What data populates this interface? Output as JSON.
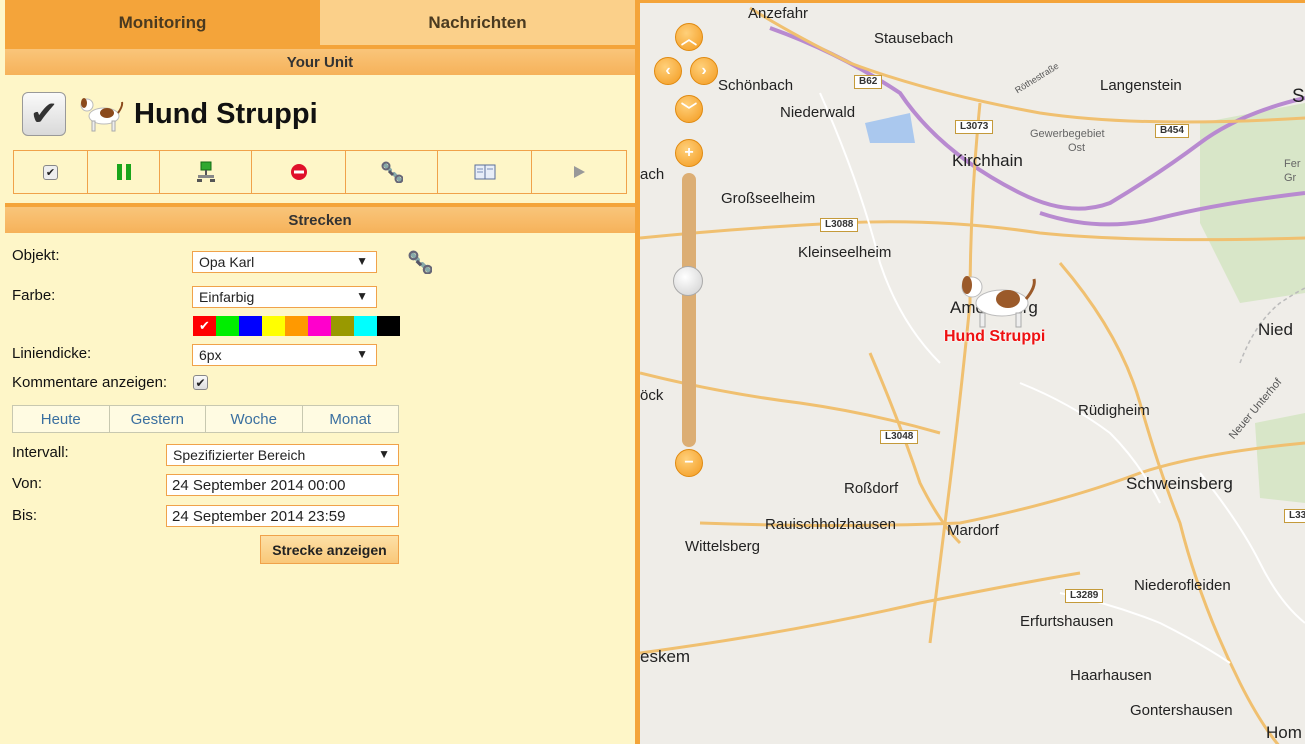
{
  "tabs": {
    "monitoring": "Monitoring",
    "messages": "Nachrichten"
  },
  "unit_section": {
    "title": "Your Unit",
    "unit_name": "Hund Struppi"
  },
  "track_section": {
    "title": "Strecken",
    "object_label": "Objekt:",
    "object_value": "Opa Karl",
    "color_label": "Farbe:",
    "color_value": "Einfarbig",
    "colors": [
      "#ff0000",
      "#00ee00",
      "#0000ff",
      "#ffff00",
      "#ff9900",
      "#ff00cc",
      "#999900",
      "#00ffff",
      "#000000"
    ],
    "width_label": "Liniendicke:",
    "width_value": "6px",
    "comments_label": "Kommentare anzeigen:",
    "periods": [
      "Heute",
      "Gestern",
      "Woche",
      "Monat"
    ],
    "interval_label": "Intervall:",
    "interval_value": "Spezifizierter Bereich",
    "from_label": "Von:",
    "from_value": "24 September 2014 00:00",
    "to_label": "Bis:",
    "to_value": "24 September 2014 23:59",
    "show_button": "Strecke anzeigen"
  },
  "map": {
    "marker_label": "Hund Struppi",
    "towns": [
      "Anzefahr",
      "Stausebach",
      "Schönbach",
      "Niederwald",
      "Langenstein",
      "Gewerbegebiet",
      "Ost",
      "Kirchhain",
      "Großseelheim",
      "Kleinseelheim",
      "Amöneburg",
      "Nied",
      "Rüdigheim",
      "Roßdorf",
      "Schweinsberg",
      "Rauischholzhausen",
      "Mardorf",
      "Wittelsberg",
      "Niederofleiden",
      "Erfurtshausen",
      "Haarhausen",
      "Gontershausen",
      "Hom",
      "eskem",
      "ach",
      "öck",
      "Fer",
      "Gr",
      "S",
      "Röthestraße",
      "Neuer Unterhof"
    ],
    "roads": [
      "B62",
      "L3073",
      "B454",
      "L3088",
      "L3048",
      "L3289",
      "L33"
    ]
  }
}
